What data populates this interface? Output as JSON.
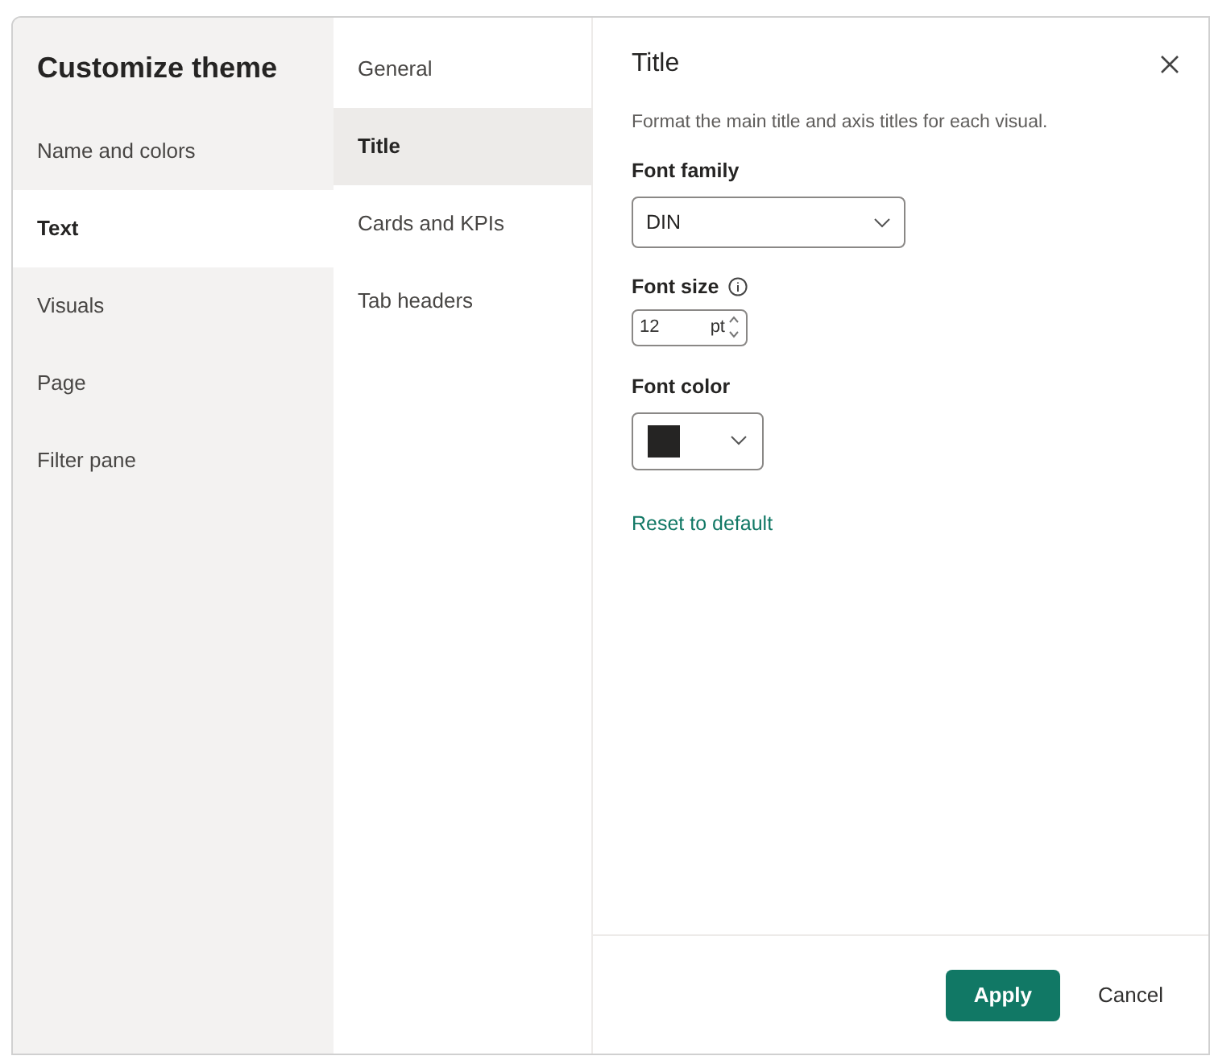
{
  "dialog": {
    "title": "Customize theme"
  },
  "sections": [
    {
      "label": "Name and colors",
      "selected": false
    },
    {
      "label": "Text",
      "selected": true
    },
    {
      "label": "Visuals",
      "selected": false
    },
    {
      "label": "Page",
      "selected": false
    },
    {
      "label": "Filter pane",
      "selected": false
    }
  ],
  "subsections": [
    {
      "label": "General",
      "selected": false
    },
    {
      "label": "Title",
      "selected": true
    },
    {
      "label": "Cards and KPIs",
      "selected": false
    },
    {
      "label": "Tab headers",
      "selected": false
    }
  ],
  "panel": {
    "title": "Title",
    "description": "Format the main title and axis titles for each visual.",
    "font_family": {
      "label": "Font family",
      "value": "DIN"
    },
    "font_size": {
      "label": "Font size",
      "value": "12",
      "unit": "pt"
    },
    "font_color": {
      "label": "Font color",
      "color": "#252423"
    },
    "reset_link": "Reset to default"
  },
  "buttons": {
    "apply": "Apply",
    "cancel": "Cancel"
  }
}
